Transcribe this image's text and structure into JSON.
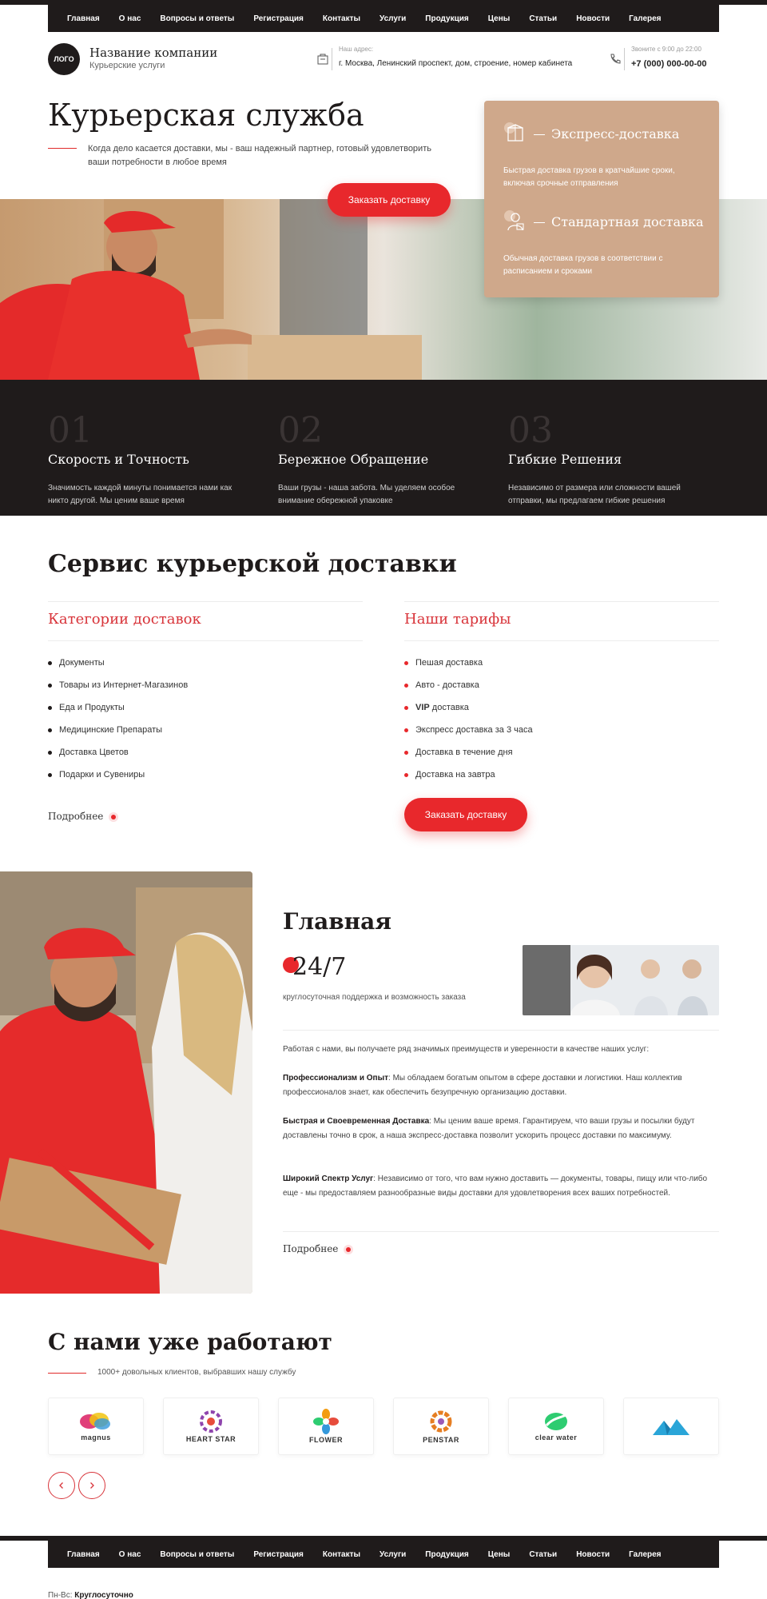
{
  "nav": {
    "items": [
      "Главная",
      "О нас",
      "Вопросы и ответы",
      "Регистрация",
      "Контакты",
      "Услуги",
      "Продукция",
      "Цены",
      "Статьи",
      "Новости",
      "Галерея"
    ]
  },
  "header": {
    "logo": "ЛОГО",
    "company_name": "Название компании",
    "company_sub": "Курьерские услуги",
    "address_label": "Наш адрес:",
    "address_value": "г. Москва, Ленинский проспект, дом, строение, номер кабинета",
    "phone_label": "Звоните с 9:00 до 22:00",
    "phone_value": "+7 (000) 000-00-00"
  },
  "hero": {
    "title": "Курьерская служба",
    "description": "Когда дело касается доставки, мы - ваш надежный партнер, готовый удовлетворить ваши потребности в любое время",
    "cta": "Заказать доставку"
  },
  "services": [
    {
      "title": "Экспресс-доставка",
      "icon": "box-icon",
      "desc": "Быстрая доставка грузов в кратчайшие сроки, включая срочные отправления"
    },
    {
      "title": "Стандартная доставка",
      "icon": "courier-icon",
      "desc": "Обычная доставка грузов в соответствии с расписанием и сроками"
    }
  ],
  "features": [
    {
      "num": "01",
      "title": "Скорость и Точность",
      "desc": "Значимость каждой минуты понимается нами как никто другой. Мы ценим ваше время"
    },
    {
      "num": "02",
      "title": "Бережное Обращение",
      "desc": "Ваши грузы - наша забота. Мы уделяем особое внимание обережной упаковке"
    },
    {
      "num": "03",
      "title": "Гибкие Решения",
      "desc": "Независимо от размера или сложности вашей отправки, мы предлагаем гибкие решения"
    }
  ],
  "service_section": {
    "title": "Сервис курьерской доставки",
    "categories_title": "Категории доставок",
    "categories": [
      "Документы",
      "Товары из Интернет-Магазинов",
      "Еда и Продукты",
      "Медицинские Препараты",
      "Доставка Цветов",
      "Подарки и Сувениры"
    ],
    "more": "Подробнее",
    "tariffs_title": "Наши тарифы",
    "tariffs": [
      {
        "bold": "",
        "text": "Пешая доставка"
      },
      {
        "bold": "",
        "text": "Авто - доставка"
      },
      {
        "bold": "VIP",
        "text": " доставка"
      },
      {
        "bold": "",
        "text": "Экспресс доставка за 3 часа"
      },
      {
        "bold": "",
        "text": "Доставка в течение дня"
      },
      {
        "bold": "",
        "text": "Доставка на завтра"
      }
    ],
    "cta": "Заказать доставку"
  },
  "about": {
    "title": "Главная",
    "big_number": "24/7",
    "support_text": "круглосуточная поддержка и возможность заказа",
    "intro": "Работая с нами, вы получаете ряд значимых преимуществ и уверенности в качестве наших услуг:",
    "p1_bold": "Профессионализм и Опыт",
    "p1_text": ": Мы обладаем богатым опытом в сфере доставки и логистики. Наш коллектив профессионалов знает, как обеспечить безупречную организацию доставки.",
    "p2_bold": "Быстрая и Своевременная Доставка",
    "p2_text": ": Мы ценим ваше время. Гарантируем, что ваши грузы и посылки будут доставлены точно в срок, а наша экспресс-доставка позволит ускорить процесс доставки по максимуму.",
    "p3_bold": "Широкий Спектр Услуг",
    "p3_text": ": Независимо от того, что вам нужно доставить — документы, товары, пищу или что-либо еще - мы предоставляем разнообразные виды доставки для удовлетворения всех ваших потребностей.",
    "more": "Подробнее"
  },
  "partners": {
    "title": "С нами уже работают",
    "subtitle": "1000+ довольных клиентов, выбравших нашу службу",
    "logos": [
      {
        "name": "magnus",
        "color": "#e0407a"
      },
      {
        "name": "HEART STAR",
        "color": "#8e44ad"
      },
      {
        "name": "FLOWER",
        "color": "#f39c12"
      },
      {
        "name": "PENSTAR",
        "color": "#e67e22"
      },
      {
        "name": "clear water",
        "color": "#27ae60"
      },
      {
        "name": "",
        "color": "#2980b9"
      }
    ]
  },
  "footer": {
    "hours_label": "Пн-Вс:",
    "hours_value": "Круглосуточно"
  },
  "colors": {
    "accent": "#e8282c",
    "dark": "#1f1b1b",
    "card": "#cfa88b"
  }
}
